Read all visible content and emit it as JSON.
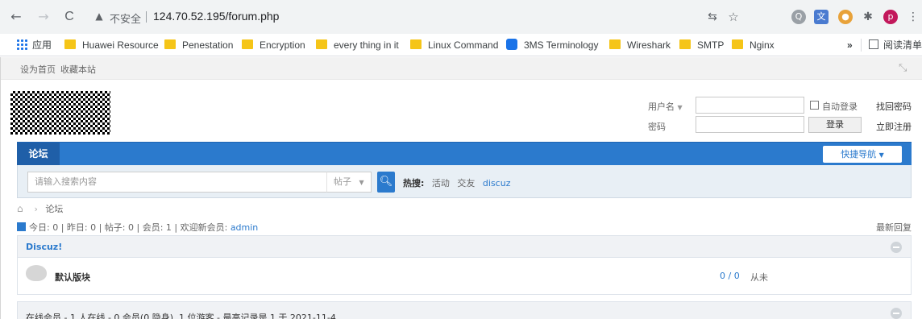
{
  "browser": {
    "back_glyph": "←",
    "forward_glyph": "→",
    "reload_glyph": "C",
    "insecure_label": "不安全",
    "url": "124.70.52.195/forum.php",
    "profile_initial": "p"
  },
  "bookmarks": {
    "apps_label": "应用",
    "items": [
      "Huawei Resource",
      "Penestation",
      "Encryption",
      "every thing in it",
      "Linux Command",
      "3MS Terminology",
      "Wireshark",
      "SMTP",
      "Nginx"
    ],
    "overflow_label": "»",
    "reading_list_label": "阅读清单"
  },
  "topbar": {
    "set_home": "设为首页",
    "bookmark_site": "收藏本站"
  },
  "login": {
    "username_label": "用户名",
    "password_label": "密码",
    "auto_login_label": "自动登录",
    "login_button": "登录",
    "find_password": "找回密码",
    "register": "立即注册"
  },
  "nav": {
    "forum_tab": "论坛",
    "quick_nav": "快捷导航"
  },
  "search": {
    "placeholder": "请输入搜索内容",
    "scope": "帖子",
    "hot_label": "热搜:",
    "hot_words": [
      "活动",
      "交友",
      "discuz"
    ]
  },
  "breadcrumb": {
    "current": "论坛"
  },
  "stats": {
    "text": "今日: 0 | 昨日: 0 | 帖子: 0 | 会员: 1 | 欢迎新会员: ",
    "new_member": "admin",
    "latest_replies": "最新回复"
  },
  "category": {
    "title": "Discuz!",
    "forums": [
      {
        "name": "默认版块",
        "count": "0 / 0",
        "last_post": "从未"
      }
    ]
  },
  "online": {
    "text": "在线会员 - 1 人在线 - 0 会员(0 隐身), 1 位游客 - 最高记录是 1 于 2021-11-4."
  }
}
